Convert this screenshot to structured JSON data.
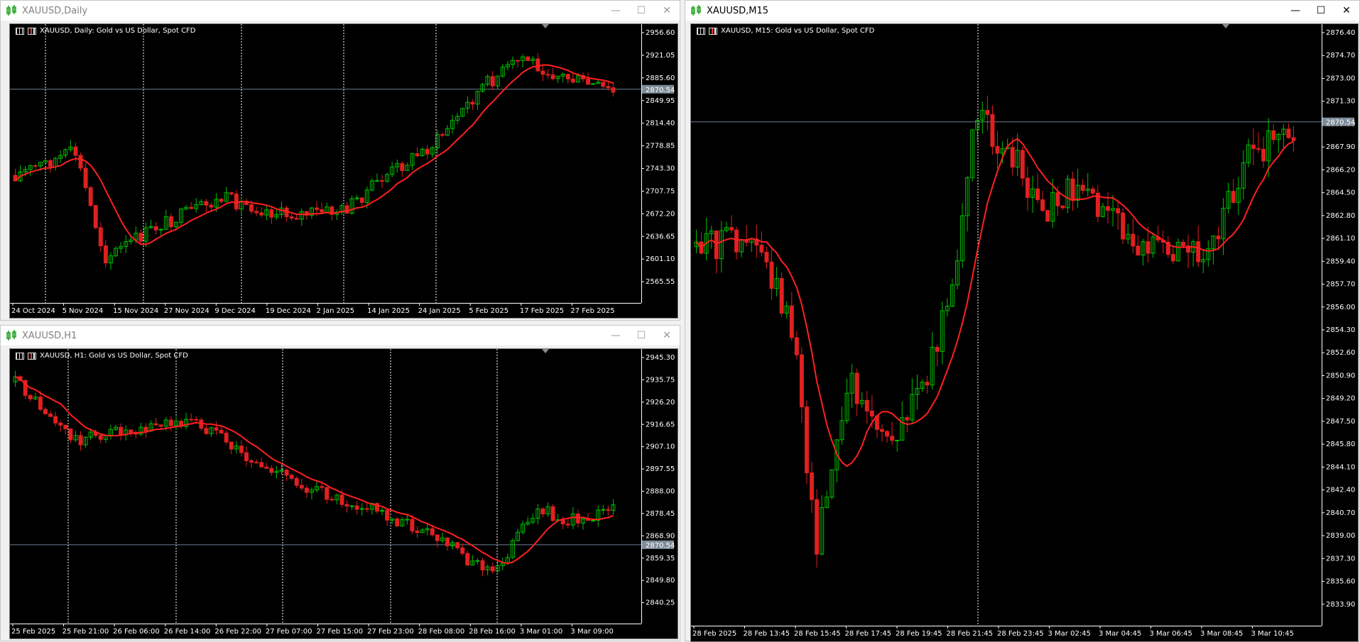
{
  "windows": {
    "daily": {
      "title": "XAUUSD,Daily",
      "info": "XAUUSD, Daily:  Gold vs US Dollar, Spot CFD",
      "price_ticks": [
        "2956.60",
        "2921.05",
        "2885.60",
        "2849.95",
        "2814.40",
        "2778.85",
        "2743.30",
        "2707.75",
        "2672.20",
        "2636.65",
        "2601.10",
        "2565.55"
      ],
      "time_ticks": [
        "24 Oct 2024",
        "5 Nov 2024",
        "15 Nov 2024",
        "27 Nov 2024",
        "9 Dec 2024",
        "19 Dec 2024",
        "2 Jan 2025",
        "14 Jan 2025",
        "24 Jan 2025",
        "5 Feb 2025",
        "17 Feb 2025",
        "27 Feb 2025"
      ],
      "current_price": "2870.54"
    },
    "h1": {
      "title": "XAUUSD,H1",
      "info": "XAUUSD, H1:  Gold vs US Dollar, Spot CFD",
      "price_ticks": [
        "2945.30",
        "2935.75",
        "2926.20",
        "2916.65",
        "2907.10",
        "2897.55",
        "2888.00",
        "2878.45",
        "2868.90",
        "2859.35",
        "2849.80",
        "2840.25"
      ],
      "time_ticks": [
        "25 Feb 2025",
        "25 Feb 21:00",
        "26 Feb 06:00",
        "26 Feb 14:00",
        "26 Feb 22:00",
        "27 Feb 07:00",
        "27 Feb 15:00",
        "27 Feb 23:00",
        "28 Feb 08:00",
        "28 Feb 16:00",
        "3 Mar 01:00",
        "3 Mar 09:00"
      ],
      "current_price": "2870.54"
    },
    "m15": {
      "title": "XAUUSD,M15",
      "info": "XAUUSD, M15:  Gold vs US Dollar, Spot CFD",
      "price_ticks": [
        "2876.40",
        "2874.70",
        "2873.00",
        "2871.30",
        "2869.60",
        "2867.90",
        "2866.20",
        "2864.50",
        "2862.80",
        "2861.10",
        "2859.40",
        "2857.70",
        "2856.00",
        "2854.30",
        "2852.60",
        "2850.90",
        "2849.20",
        "2847.50",
        "2845.80",
        "2844.10",
        "2842.40",
        "2840.70",
        "2839.00",
        "2837.30",
        "2835.60",
        "2833.90"
      ],
      "time_ticks": [
        "28 Feb 2025",
        "28 Feb 13:45",
        "28 Feb 15:45",
        "28 Feb 17:45",
        "28 Feb 19:45",
        "28 Feb 21:45",
        "28 Feb 23:45",
        "3 Mar 02:45",
        "3 Mar 04:45",
        "3 Mar 06:45",
        "3 Mar 08:45",
        "3 Mar 10:45"
      ],
      "current_price": "2870.54"
    }
  },
  "buttons": {
    "minimize": "—",
    "maximize": "☐",
    "close": "✕"
  },
  "colors": {
    "bull": "#00c000",
    "bear": "#e02020",
    "ma": "#ff2020",
    "grid": "#ffffff",
    "bg": "#000000",
    "price_line": "#6f7f8f"
  }
}
